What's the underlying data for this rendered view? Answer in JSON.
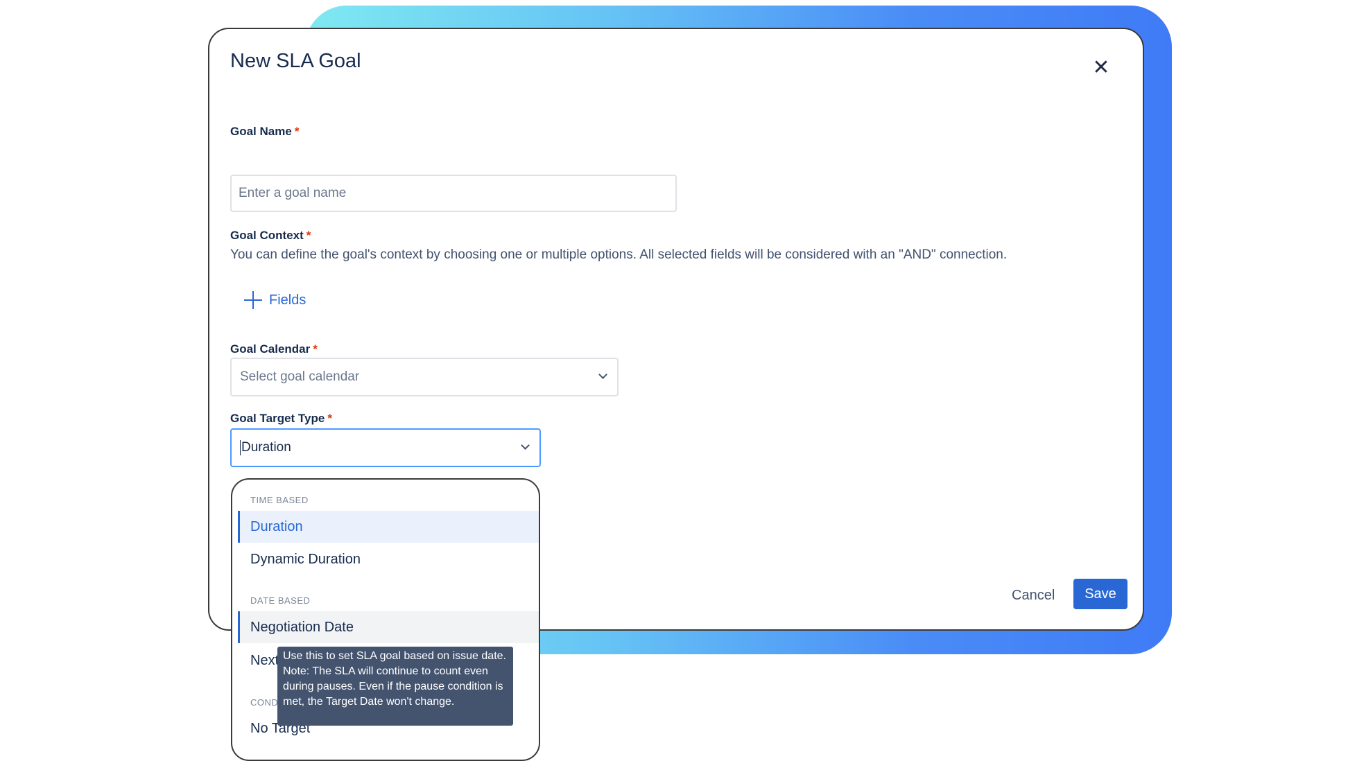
{
  "modal": {
    "title": "New SLA Goal",
    "close_icon": "close-icon"
  },
  "goal_name": {
    "label": "Goal Name",
    "required_mark": "*",
    "placeholder": "Enter a goal name",
    "value": ""
  },
  "goal_context": {
    "label": "Goal Context",
    "required_mark": "*",
    "description": "You can define the goal's context by choosing one or multiple options. All selected fields will be considered with an \"AND\" connection.",
    "add_fields_label": "Fields",
    "add_icon": "plus-icon"
  },
  "goal_calendar": {
    "label": "Goal Calendar",
    "required_mark": "*",
    "placeholder": "Select goal calendar",
    "chevron_icon": "chevron-down-icon"
  },
  "goal_target_type": {
    "label": "Goal Target Type",
    "required_mark": "*",
    "value": "Duration",
    "chevron_icon": "chevron-down-icon"
  },
  "dropdown": {
    "groups": [
      {
        "heading": "TIME BASED",
        "options": [
          "Duration",
          "Dynamic Duration"
        ]
      },
      {
        "heading": "DATE BASED",
        "options": [
          "Negotiation Date",
          "Next"
        ]
      },
      {
        "heading": "COND",
        "options": [
          "No Target"
        ]
      }
    ],
    "selected": "Duration",
    "hovered": "Negotiation Date"
  },
  "tooltip": {
    "text": "Use this to set SLA goal based on issue date. Note: The SLA will continue to count even during pauses. Even if the pause condition is met, the Target Date won't change."
  },
  "footer": {
    "cancel_label": "Cancel",
    "save_label": "Save"
  },
  "colors": {
    "accent": "#2968d4",
    "required": "#de350b",
    "focus_border": "#4c9aff",
    "tooltip_bg": "#44546f"
  }
}
